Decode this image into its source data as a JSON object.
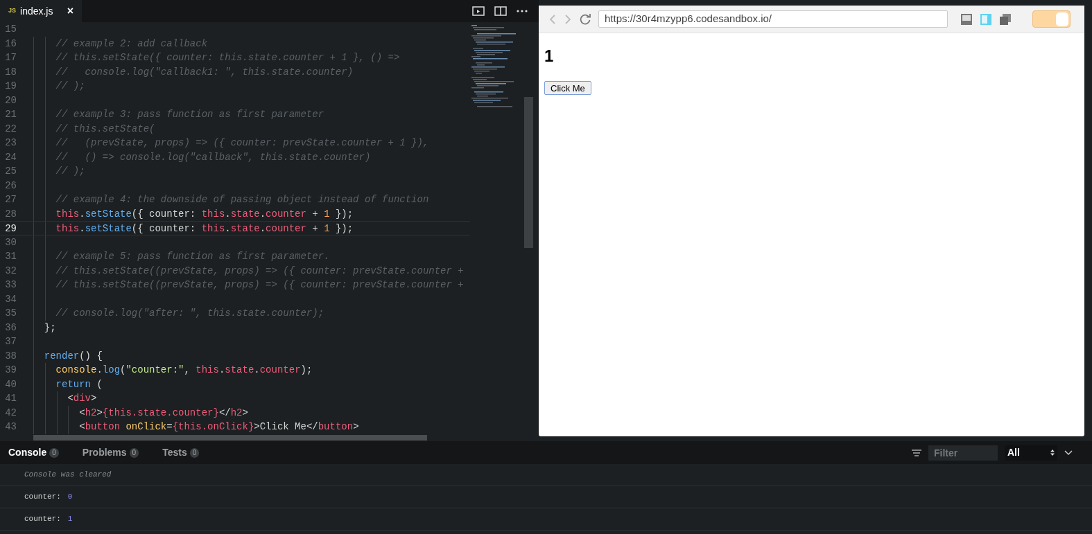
{
  "editor": {
    "tabs": [
      {
        "badge": "JS",
        "label": "index.js",
        "close": "×",
        "selected": true
      }
    ],
    "lines": [
      {
        "number": "15",
        "current": false
      },
      {
        "number": "16",
        "current": false,
        "tokens": [
          {
            "kind": "comment",
            "text": "    // example 2: add callback"
          }
        ]
      },
      {
        "number": "17",
        "current": false,
        "tokens": [
          {
            "kind": "comment",
            "text": "    // this.setState({ counter: this.state.counter + 1 }, () =>"
          }
        ]
      },
      {
        "number": "18",
        "current": false,
        "tokens": [
          {
            "kind": "comment",
            "text": "    //   console.log(\"callback1: \", this.state.counter)"
          }
        ]
      },
      {
        "number": "19",
        "current": false,
        "tokens": [
          {
            "kind": "comment",
            "text": "    // );"
          }
        ]
      },
      {
        "number": "20",
        "current": false
      },
      {
        "number": "21",
        "current": false,
        "tokens": [
          {
            "kind": "comment",
            "text": "    // example 3: pass function as first parameter"
          }
        ]
      },
      {
        "number": "22",
        "current": false,
        "tokens": [
          {
            "kind": "comment",
            "text": "    // this.setState("
          }
        ]
      },
      {
        "number": "23",
        "current": false,
        "tokens": [
          {
            "kind": "comment",
            "text": "    //   (prevState, props) => ({ counter: prevState.counter + 1 }),"
          }
        ]
      },
      {
        "number": "24",
        "current": false,
        "tokens": [
          {
            "kind": "comment",
            "text": "    //   () => console.log(\"callback\", this.state.counter)"
          }
        ]
      },
      {
        "number": "25",
        "current": false,
        "tokens": [
          {
            "kind": "comment",
            "text": "    // );"
          }
        ]
      },
      {
        "number": "26",
        "current": false
      },
      {
        "number": "27",
        "current": false,
        "tokens": [
          {
            "kind": "comment",
            "text": "    // example 4: the downside of passing object instead of function"
          }
        ]
      },
      {
        "number": "28",
        "current": false,
        "tokens": [
          {
            "kind": "keyword",
            "text": "    this"
          },
          {
            "kind": "plain",
            "text": "."
          },
          {
            "kind": "func",
            "text": "setState"
          },
          {
            "kind": "plain",
            "text": "({ counter: "
          },
          {
            "kind": "keyword",
            "text": "this"
          },
          {
            "kind": "plain",
            "text": "."
          },
          {
            "kind": "prop",
            "text": "state"
          },
          {
            "kind": "plain",
            "text": "."
          },
          {
            "kind": "prop",
            "text": "counter"
          },
          {
            "kind": "plain",
            "text": " + "
          },
          {
            "kind": "number",
            "text": "1"
          },
          {
            "kind": "plain",
            "text": " });"
          }
        ]
      },
      {
        "number": "29",
        "current": true,
        "tokens": [
          {
            "kind": "keyword",
            "text": "    this"
          },
          {
            "kind": "plain",
            "text": "."
          },
          {
            "kind": "func",
            "text": "setState"
          },
          {
            "kind": "plain",
            "text": "({ counter: "
          },
          {
            "kind": "keyword",
            "text": "this"
          },
          {
            "kind": "plain",
            "text": "."
          },
          {
            "kind": "prop",
            "text": "state"
          },
          {
            "kind": "plain",
            "text": "."
          },
          {
            "kind": "prop",
            "text": "counter"
          },
          {
            "kind": "plain",
            "text": " + "
          },
          {
            "kind": "number",
            "text": "1"
          },
          {
            "kind": "plain",
            "text": " });"
          }
        ]
      },
      {
        "number": "30",
        "current": false
      },
      {
        "number": "31",
        "current": false,
        "tokens": [
          {
            "kind": "comment",
            "text": "    // example 5: pass function as first parameter."
          }
        ]
      },
      {
        "number": "32",
        "current": false,
        "tokens": [
          {
            "kind": "comment",
            "text": "    // this.setState((prevState, props) => ({ counter: prevState.counter +"
          }
        ]
      },
      {
        "number": "33",
        "current": false,
        "tokens": [
          {
            "kind": "comment",
            "text": "    // this.setState((prevState, props) => ({ counter: prevState.counter +"
          }
        ]
      },
      {
        "number": "34",
        "current": false
      },
      {
        "number": "35",
        "current": false,
        "tokens": [
          {
            "kind": "comment",
            "text": "    // console.log(\"after: \", this.state.counter);"
          }
        ]
      },
      {
        "number": "36",
        "current": false,
        "tokens": [
          {
            "kind": "plain",
            "text": "  };"
          }
        ]
      },
      {
        "number": "37",
        "current": false
      },
      {
        "number": "38",
        "current": false,
        "tokens": [
          {
            "kind": "func",
            "text": "  render"
          },
          {
            "kind": "plain",
            "text": "() {"
          }
        ]
      },
      {
        "number": "39",
        "current": false,
        "tokens": [
          {
            "kind": "object",
            "text": "    console"
          },
          {
            "kind": "plain",
            "text": "."
          },
          {
            "kind": "func",
            "text": "log"
          },
          {
            "kind": "plain",
            "text": "("
          },
          {
            "kind": "string",
            "text": "\"counter:\""
          },
          {
            "kind": "plain",
            "text": ", "
          },
          {
            "kind": "keyword",
            "text": "this"
          },
          {
            "kind": "plain",
            "text": "."
          },
          {
            "kind": "prop",
            "text": "state"
          },
          {
            "kind": "plain",
            "text": "."
          },
          {
            "kind": "prop",
            "text": "counter"
          },
          {
            "kind": "plain",
            "text": ");"
          }
        ]
      },
      {
        "number": "40",
        "current": false,
        "tokens": [
          {
            "kind": "func",
            "text": "    return"
          },
          {
            "kind": "plain",
            "text": " ("
          }
        ]
      },
      {
        "number": "41",
        "current": false,
        "tokens": [
          {
            "kind": "plain",
            "text": "      <"
          },
          {
            "kind": "tag",
            "text": "div"
          },
          {
            "kind": "plain",
            "text": ">"
          }
        ]
      },
      {
        "number": "42",
        "current": false,
        "tokens": [
          {
            "kind": "plain",
            "text": "        <"
          },
          {
            "kind": "tag",
            "text": "h2"
          },
          {
            "kind": "plain",
            "text": ">"
          },
          {
            "kind": "tag",
            "text": "{this.state.counter}"
          },
          {
            "kind": "plain",
            "text": "</"
          },
          {
            "kind": "tag",
            "text": "h2"
          },
          {
            "kind": "plain",
            "text": ">"
          }
        ]
      },
      {
        "number": "43",
        "current": false,
        "tokens": [
          {
            "kind": "plain",
            "text": "        <"
          },
          {
            "kind": "tag",
            "text": "button"
          },
          {
            "kind": "attr",
            "text": " onClick"
          },
          {
            "kind": "plain",
            "text": "="
          },
          {
            "kind": "tag",
            "text": "{this.onClick}"
          },
          {
            "kind": "plain",
            "text": ">Click Me</"
          },
          {
            "kind": "tag",
            "text": "button"
          },
          {
            "kind": "plain",
            "text": ">"
          }
        ]
      }
    ]
  },
  "preview": {
    "url": "https://30r4mzypp6.codesandbox.io/",
    "heading": "1",
    "button": "Click Me",
    "toggle": {
      "on": true
    }
  },
  "console": {
    "tabs": [
      {
        "label": "Console",
        "count": "0",
        "selected": true
      },
      {
        "label": "Problems",
        "count": "0",
        "selected": false
      },
      {
        "label": "Tests",
        "count": "0",
        "selected": false
      }
    ],
    "filter": {
      "placeholder": "Filter"
    },
    "level": "All",
    "messages": [
      {
        "kind": "info",
        "text": "Console was cleared"
      },
      {
        "kind": "log",
        "label": "counter:",
        "value": "0"
      },
      {
        "kind": "log",
        "label": "counter:",
        "value": "1"
      }
    ]
  }
}
